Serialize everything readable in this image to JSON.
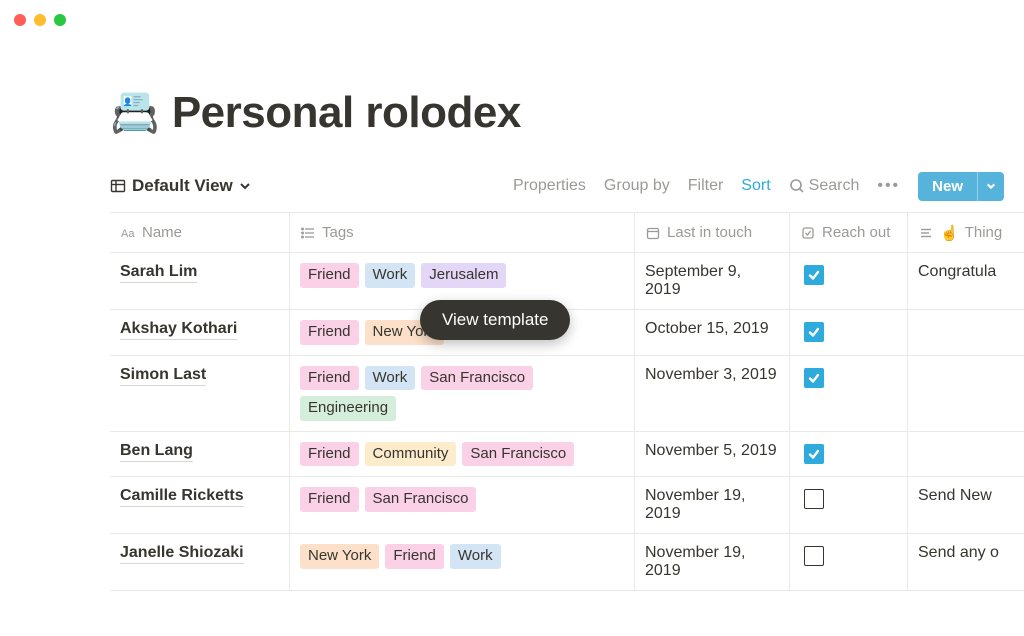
{
  "window": {
    "title": "Personal rolodex"
  },
  "page": {
    "icon": "📇",
    "title": "Personal rolodex"
  },
  "view": {
    "selector": "Default View"
  },
  "toolbar": {
    "properties": "Properties",
    "groupby": "Group by",
    "filter": "Filter",
    "sort": "Sort",
    "search": "Search",
    "new": "New"
  },
  "columns": {
    "name": "Name",
    "tags": "Tags",
    "last": "Last in touch",
    "reach": "Reach out",
    "things": "Thing"
  },
  "tooltip": "View template",
  "tagColors": {
    "Friend": "tag-pink",
    "Work": "tag-blue",
    "Jerusalem": "tag-purple",
    "New York": "tag-orange",
    "San Francisco": "tag-pink",
    "Engineering": "tag-green",
    "Community": "tag-yellow"
  },
  "rows": [
    {
      "name": "Sarah Lim",
      "tags": [
        "Friend",
        "Work",
        "Jerusalem"
      ],
      "last": "September 9, 2019",
      "reach": true,
      "things": "Congratula"
    },
    {
      "name": "Akshay Kothari",
      "tags": [
        "Friend",
        "New York"
      ],
      "last": "October 15, 2019",
      "reach": true,
      "things": ""
    },
    {
      "name": "Simon Last",
      "tags": [
        "Friend",
        "Work",
        "San Francisco",
        "Engineering"
      ],
      "last": "November 3, 2019",
      "reach": true,
      "things": ""
    },
    {
      "name": "Ben Lang",
      "tags": [
        "Friend",
        "Community",
        "San Francisco"
      ],
      "last": "November 5, 2019",
      "reach": true,
      "things": ""
    },
    {
      "name": "Camille Ricketts",
      "tags": [
        "Friend",
        "San Francisco"
      ],
      "last": "November 19, 2019",
      "reach": false,
      "things": "Send New"
    },
    {
      "name": "Janelle Shiozaki",
      "tags": [
        "New York",
        "Friend",
        "Work"
      ],
      "last": "November 19, 2019",
      "reach": false,
      "things": "Send any o"
    }
  ]
}
